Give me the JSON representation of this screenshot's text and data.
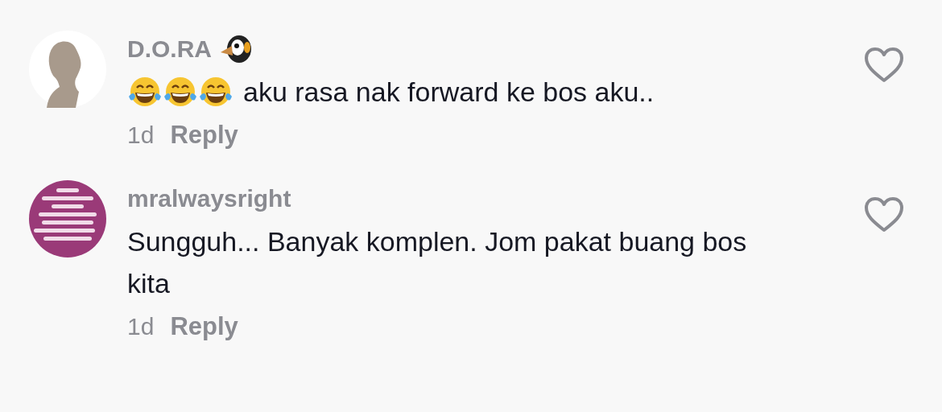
{
  "comments": [
    {
      "avatar": {
        "kind": "silhouette"
      },
      "username": "D.O.RA",
      "username_icon": {
        "kind": "penguin"
      },
      "message_icons": [
        {
          "kind": "laugh"
        },
        {
          "kind": "laugh"
        },
        {
          "kind": "laugh"
        }
      ],
      "message": "aku rasa nak forward ke bos aku..",
      "time": "1d",
      "reply": "Reply",
      "liked": false
    },
    {
      "username": "mralwaysright",
      "message": "Sungguh... Banyak komplen. Jom pakat buang bos kita",
      "time": "1d",
      "reply": "Reply",
      "liked": false
    }
  ]
}
